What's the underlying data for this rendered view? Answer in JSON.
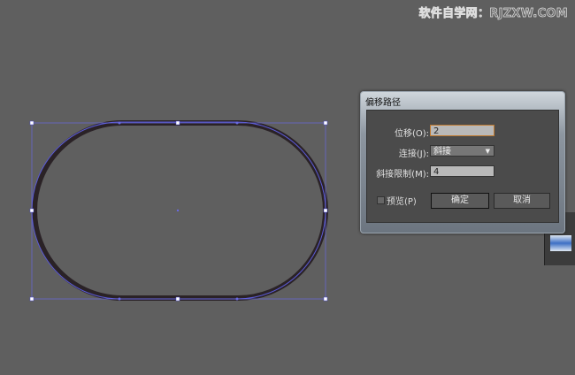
{
  "watermark": "软件自学网：RJZXW.COM",
  "dialog": {
    "title": "偏移路径",
    "offset_label": "位移(O):",
    "offset_value": "2",
    "joins_label": "连接(J):",
    "joins_value": "斜接",
    "miter_label": "斜接限制(M):",
    "miter_value": "4",
    "preview_label": "预览(P)",
    "preview_checked": false,
    "ok_label": "确定",
    "cancel_label": "取消"
  }
}
